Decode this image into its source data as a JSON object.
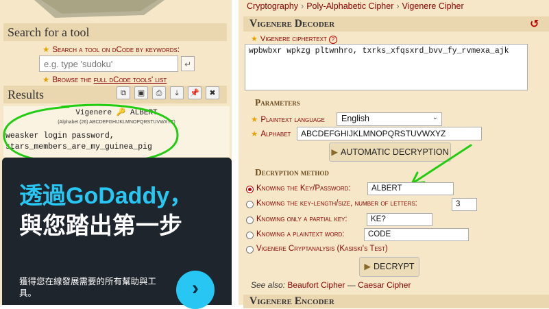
{
  "left_panel": {
    "search_heading": "Search for a tool",
    "search_label": "Search a tool on dCode by keywords:",
    "search_placeholder": "e.g. type 'sudoku'",
    "search_button_icon": "enter-icon",
    "browse_prefix": "Browse the ",
    "browse_link": "full dCode tools' list",
    "results_heading": "Results",
    "results_toolbar": [
      {
        "icon": "copy-icon",
        "glyph": "⧉"
      },
      {
        "icon": "save-icon",
        "glyph": "▣"
      },
      {
        "icon": "print-icon",
        "glyph": "⎙"
      },
      {
        "icon": "download-icon",
        "glyph": "⤓"
      },
      {
        "icon": "pin-icon",
        "glyph": "📌"
      },
      {
        "icon": "close-icon",
        "glyph": "✖"
      }
    ],
    "result_title": "Vigenere 🔑 ALBERT",
    "result_alphabet": "(Alphabet (26) ABCDEFGHIJKLMNOPQRSTUVWXYZ)",
    "result_text": "weasker login password,\nstars_members_are_my_guinea_pig"
  },
  "ad": {
    "title_line1": "透過GoDaddy，",
    "title_line2": "與您踏出第一步",
    "subtitle": "獲得您在線發展需要的所有幫助與工具。",
    "arrow_glyph": "›"
  },
  "breadcrumb": [
    "Cryptography",
    "Poly-Alphabetic Cipher",
    "Vigenere Cipher"
  ],
  "decoder": {
    "heading": "Vigenere Decoder",
    "ciphertext_label": "Vigenere ciphertext",
    "ciphertext_value": "wpbwbxr wpkzg pltwnhro, txrks_xfqsxrd_bvv_fy_rvmexa_ajk",
    "parameters_heading": "Parameters",
    "plaintext_language_label": "Plaintext language",
    "plaintext_language_value": "English",
    "alphabet_label": "Alphabet",
    "alphabet_value": "ABCDEFGHIJKLMNOPQRSTUVWXYZ",
    "auto_button": "AUTOMATIC DECRYPTION",
    "method_heading": "Decryption method",
    "methods": [
      {
        "label": "Knowing the Key/Password:",
        "value": "ALBERT",
        "selected": true
      },
      {
        "label": "Knowing the key-length/size, number of letters:",
        "value": "3",
        "selected": false
      },
      {
        "label": "Knowing only a partial key:",
        "value": "KE?",
        "selected": false
      },
      {
        "label": "Knowing a plaintext word:",
        "value": "CODE",
        "selected": false
      },
      {
        "label": "Vigenere Cryptanalysis (Kasiski's Test)",
        "value": null,
        "selected": false
      }
    ],
    "decrypt_button": "DECRYPT",
    "see_also_label": "See also:",
    "see_also_links": [
      "Beaufort Cipher",
      "Caesar Cipher"
    ],
    "see_also_sep": " — "
  },
  "encoder": {
    "heading": "Vigenere Encoder"
  },
  "annotation_color": "#22cc11"
}
